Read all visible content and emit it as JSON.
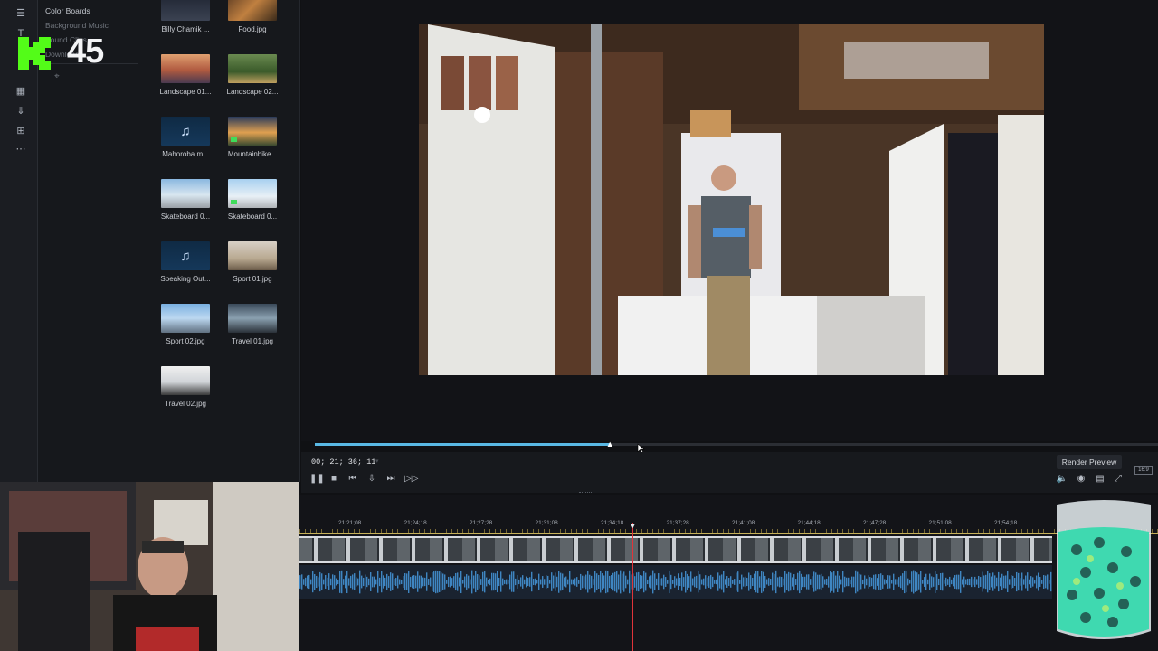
{
  "sidebar": {
    "categories": [
      {
        "label": "Color Boards",
        "dim": false
      },
      {
        "label": "Background Music",
        "dim": true
      },
      {
        "label": "Sound Clips",
        "dim": true
      },
      {
        "label": "Downloads",
        "dim": true
      }
    ],
    "icons": [
      "media-icon",
      "text-icon",
      "effects-icon",
      "download-icon",
      "pin-icon",
      "grid-icon",
      "more-icon"
    ]
  },
  "overlay": {
    "kick_count": "45"
  },
  "library": {
    "items": [
      {
        "label": "Billy Chamik ...",
        "kind": "text-doc"
      },
      {
        "label": "Food.jpg",
        "kind": "food"
      },
      {
        "label": "Landscape 01...",
        "kind": "sunset"
      },
      {
        "label": "Landscape 02...",
        "kind": "forest"
      },
      {
        "label": "Mahoroba.m...",
        "kind": "music"
      },
      {
        "label": "Mountainbike...",
        "kind": "mountain"
      },
      {
        "label": "Skateboard 0...",
        "kind": "skate1"
      },
      {
        "label": "Skateboard 0...",
        "kind": "skate2"
      },
      {
        "label": "Speaking Out...",
        "kind": "music"
      },
      {
        "label": "Sport 01.jpg",
        "kind": "sport1"
      },
      {
        "label": "Sport 02.jpg",
        "kind": "sport2"
      },
      {
        "label": "Travel 01.jpg",
        "kind": "travel1"
      },
      {
        "label": "Travel 02.jpg",
        "kind": "travel2"
      }
    ]
  },
  "preview": {
    "progress": 0.35
  },
  "transport": {
    "timecode": "00; 21; 36; 11",
    "render_label": "Render Preview",
    "ratio_label": "16:9"
  },
  "timeline": {
    "ruler_labels": [
      "21;21;08",
      "21;24;18",
      "21;27;28",
      "21;31;08",
      "21;34;18",
      "21;37;28",
      "21;41;08",
      "21;44;18",
      "21;47;28",
      "21;51;08",
      "21;54;18"
    ]
  },
  "colors": {
    "accent": "#59b8e4",
    "playhead": "#e0343a",
    "kick_green": "#53fc18"
  }
}
